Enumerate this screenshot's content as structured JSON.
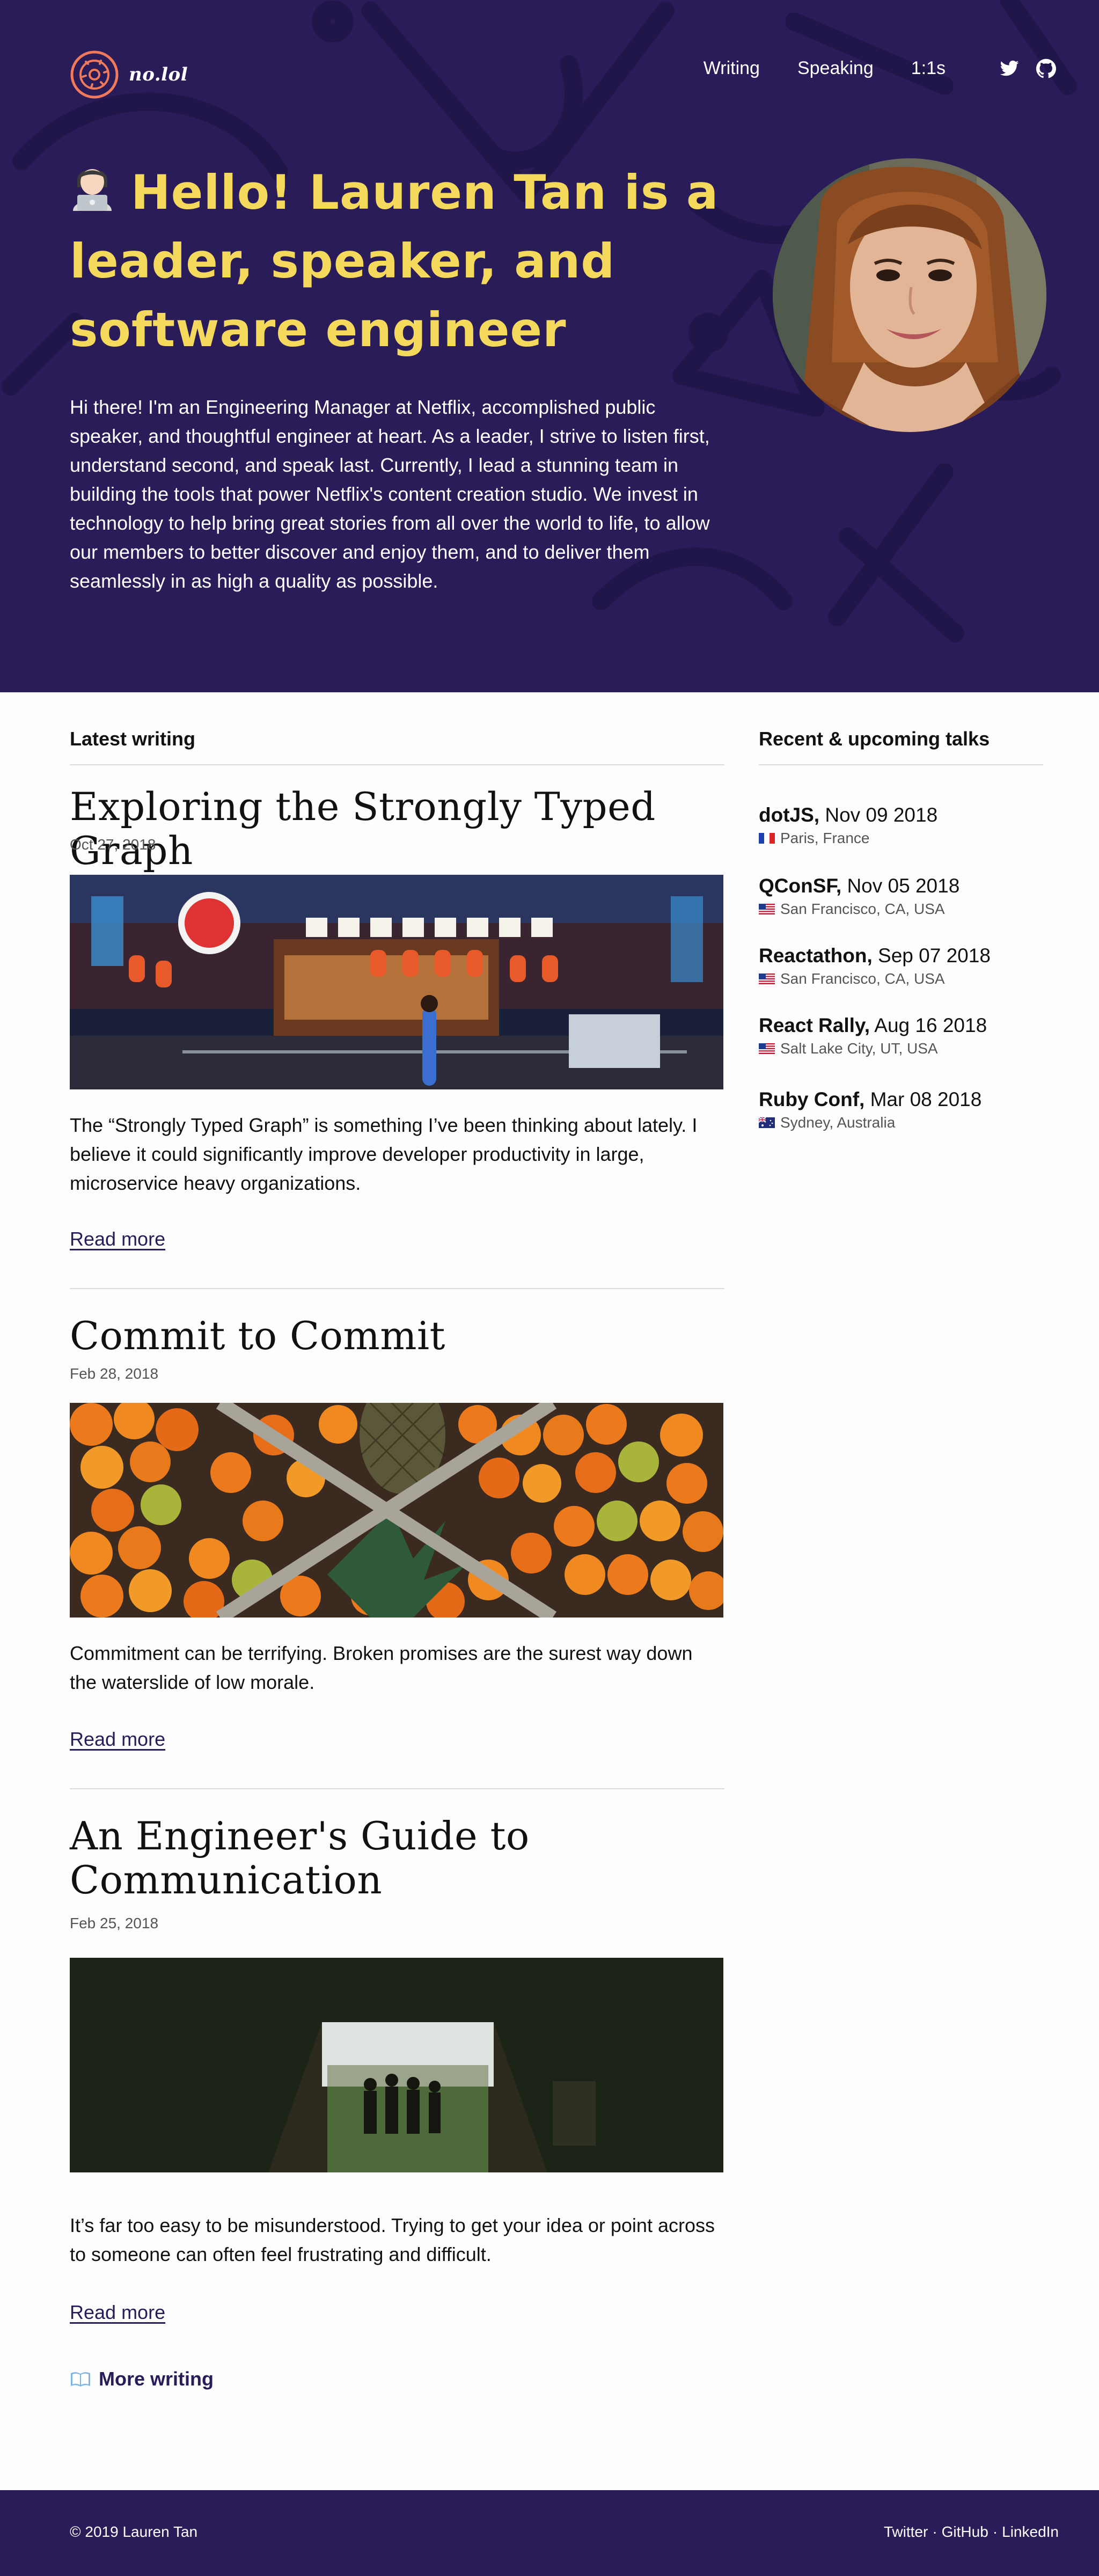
{
  "brand": {
    "name": "no.lol",
    "colors": {
      "hero_bg": "#291c58",
      "title_yellow": "#f4d95c",
      "logo_orange": "#f07a5a"
    }
  },
  "nav": {
    "items": [
      "Writing",
      "Speaking",
      "1:1s"
    ],
    "icons": [
      "twitter-icon",
      "github-icon"
    ]
  },
  "hero": {
    "emoji": "technologist-emoji",
    "title": "Hello! Lauren Tan is a leader, speaker, and software engineer",
    "intro": "Hi there! I'm an Engineering Manager at Netflix, accomplished public speaker, and thoughtful engineer at heart. As a leader, I strive to listen first, understand second, and speak last. Currently, I lead a stunning team in building the tools that power Netflix's content creation studio. We invest in technology to help bring great stories from all over the world to life, to allow our members to better discover and enjoy them, and to deliver them seamlessly in as high a quality as possible."
  },
  "writing": {
    "heading": "Latest writing",
    "read_more_label": "Read more",
    "posts": [
      {
        "title": "Exploring the Strongly Typed Graph",
        "date": "Oct 27, 2018",
        "excerpt": "The “Strongly Typed Graph” is something I’ve been thinking about lately. I believe it could significantly improve developer productivity in large, microservice heavy organizations."
      },
      {
        "title": "Commit to Commit",
        "date": "Feb 28, 2018",
        "excerpt": "Commitment can be terrifying. Broken promises are the surest way down the waterslide of low morale."
      },
      {
        "title": "An Engineer's Guide to Communication",
        "date": "Feb 25, 2018",
        "excerpt": "It’s far too easy to be misunderstood. Trying to get your idea or point across to someone can often feel frustrating and difficult."
      }
    ],
    "more_label": "More writing"
  },
  "talks": {
    "heading": "Recent & upcoming talks",
    "items": [
      {
        "name": "dotJS,",
        "date": "Nov 09 2018",
        "location": "Paris, France",
        "flag": "fr"
      },
      {
        "name": "QConSF,",
        "date": "Nov 05 2018",
        "location": "San Francisco, CA, USA",
        "flag": "us"
      },
      {
        "name": "Reactathon,",
        "date": "Sep 07 2018",
        "location": "San Francisco, CA, USA",
        "flag": "us"
      },
      {
        "name": "React Rally,",
        "date": "Aug 16 2018",
        "location": "Salt Lake City, UT, USA",
        "flag": "us"
      },
      {
        "name": "Ruby Conf,",
        "date": "Mar 08 2018",
        "location": "Sydney, Australia",
        "flag": "au"
      }
    ]
  },
  "footer": {
    "copyright": "© 2019 Lauren Tan",
    "links": [
      "Twitter",
      "GitHub",
      "LinkedIn"
    ],
    "separator": "·"
  }
}
